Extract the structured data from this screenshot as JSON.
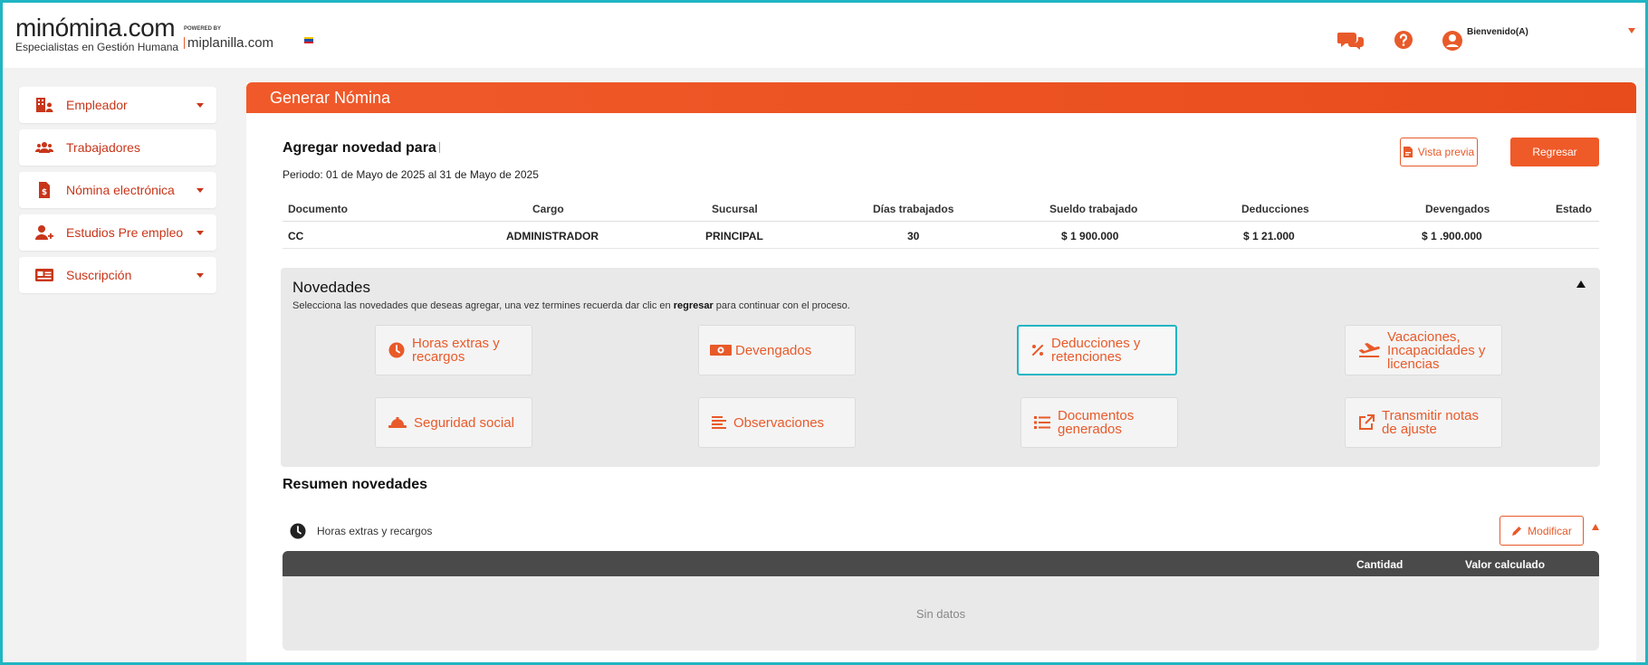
{
  "header": {
    "logo_main": "minómina.com",
    "logo_sub": "Especialistas en Gestión Humana",
    "powered_by": "POWERED BY",
    "partner": "miplanilla.com",
    "welcome": "Bienvenido(A)",
    "accent": "#e85a2a"
  },
  "sidebar": {
    "items": [
      {
        "label": "Empleador",
        "icon": "building-user-icon",
        "has_caret": true
      },
      {
        "label": "Trabajadores",
        "icon": "users-icon",
        "has_caret": false
      },
      {
        "label": "Nómina electrónica",
        "icon": "payroll-file-icon",
        "has_caret": true
      },
      {
        "label": "Estudios Pre empleo",
        "icon": "user-plus-icon",
        "has_caret": true
      },
      {
        "label": "Suscripción",
        "icon": "id-card-icon",
        "has_caret": true
      }
    ]
  },
  "main": {
    "title": "Generar Nómina",
    "section_title": "Agregar novedad para",
    "periodo": "Periodo: 01 de Mayo de 2025 al 31 de Mayo de 2025",
    "btn_preview": "Vista previa",
    "btn_back": "Regresar",
    "table": {
      "headers": [
        "Documento",
        "Cargo",
        "Sucursal",
        "Días trabajados",
        "Sueldo trabajado",
        "Deducciones",
        "Devengados",
        "Estado"
      ],
      "row": [
        "CC",
        "ADMINISTRADOR",
        "PRINCIPAL",
        "30",
        "$ 1  900.000",
        "$ 1  21.000",
        "$ 1  .900.000",
        ""
      ]
    },
    "novedades": {
      "title": "Novedades",
      "desc_pre": "Selecciona las novedades que deseas agregar, una vez termines recuerda dar clic en ",
      "desc_bold": "regresar",
      "desc_post": " para continuar con el proceso.",
      "tiles": [
        {
          "label": "Horas extras y recargos",
          "icon": "clock-icon"
        },
        {
          "label": "Devengados",
          "icon": "money-icon"
        },
        {
          "label": "Deducciones y retenciones",
          "icon": "percent-icon"
        },
        {
          "label": "Vacaciones, Incapacidades y licencias",
          "icon": "plane-icon"
        },
        {
          "label": "Seguridad social",
          "icon": "hard-hat-icon"
        },
        {
          "label": "Observaciones",
          "icon": "align-left-icon"
        },
        {
          "label": "Documentos generados",
          "icon": "list-icon"
        },
        {
          "label": "Transmitir notas de ajuste",
          "icon": "external-link-icon"
        }
      ]
    },
    "resumen": {
      "title": "Resumen novedades",
      "subtitle": "Horas extras y recargos",
      "btn_modify": "Modificar",
      "col_cantidad": "Cantidad",
      "col_valor": "Valor calculado",
      "empty": "Sin datos"
    }
  }
}
